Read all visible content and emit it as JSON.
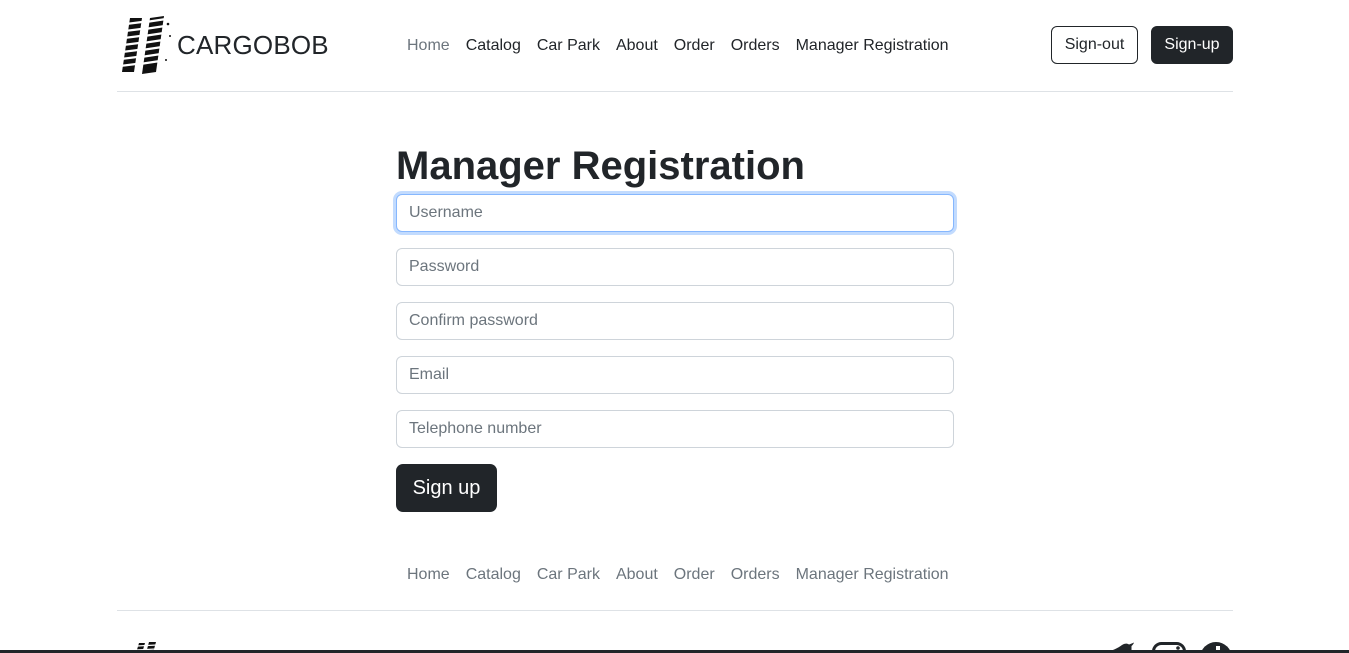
{
  "brand": {
    "name": "CARGOBOB"
  },
  "nav": {
    "items": [
      {
        "label": "Home"
      },
      {
        "label": "Catalog"
      },
      {
        "label": "Car Park"
      },
      {
        "label": "About"
      },
      {
        "label": "Order"
      },
      {
        "label": "Orders"
      },
      {
        "label": "Manager Registration"
      }
    ],
    "active": "Home"
  },
  "auth": {
    "signout_label": "Sign-out",
    "signup_label": "Sign-up"
  },
  "page": {
    "title": "Manager Registration"
  },
  "form": {
    "username": {
      "placeholder": "Username",
      "value": ""
    },
    "password": {
      "placeholder": "Password",
      "value": ""
    },
    "confirm_password": {
      "placeholder": "Confirm password",
      "value": ""
    },
    "email": {
      "placeholder": "Email",
      "value": ""
    },
    "telephone": {
      "placeholder": "Telephone number",
      "value": ""
    },
    "submit_label": "Sign up"
  },
  "footer": {
    "nav": [
      {
        "label": "Home"
      },
      {
        "label": "Catalog"
      },
      {
        "label": "Car Park"
      },
      {
        "label": "About"
      },
      {
        "label": "Order"
      },
      {
        "label": "Orders"
      },
      {
        "label": "Manager Registration"
      }
    ],
    "social": [
      "twitter-icon",
      "instagram-icon",
      "facebook-icon"
    ]
  },
  "colors": {
    "dark": "#212529",
    "muted": "#6c757d",
    "focus": "#86b7fe",
    "border": "#ced4da"
  }
}
